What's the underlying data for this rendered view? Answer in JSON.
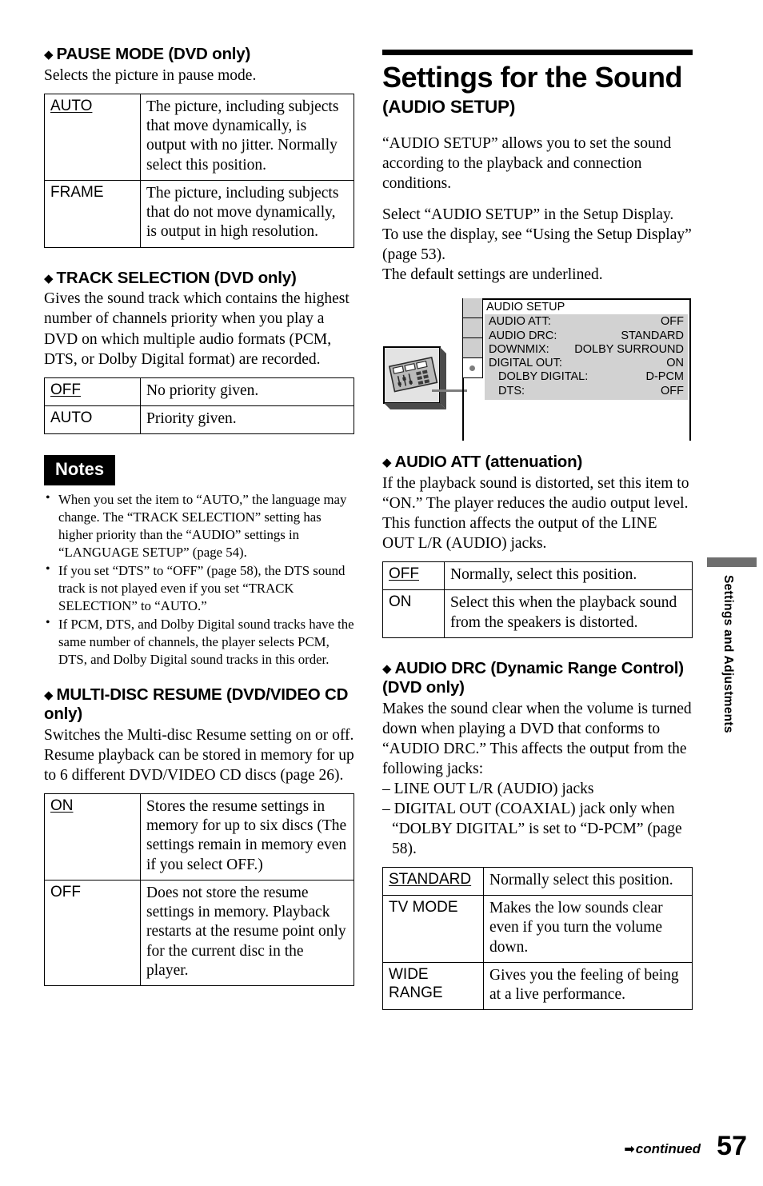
{
  "page": {
    "number": "57",
    "continued_label": "continued",
    "continued_arrow": "➡",
    "side_tab_label": "Settings and Adjustments"
  },
  "left_column": {
    "pause_mode": {
      "diamond": "◆",
      "heading": "PAUSE MODE (DVD only)",
      "intro": "Selects the picture in pause mode.",
      "table": [
        {
          "key": "AUTO",
          "default": true,
          "value": "The picture, including subjects that move dynamically, is output with no jitter. Normally select this position."
        },
        {
          "key": "FRAME",
          "default": false,
          "value": "The picture, including subjects that do not move dynamically, is output in high resolution."
        }
      ]
    },
    "track_selection": {
      "diamond": "◆",
      "heading": "TRACK SELECTION (DVD only)",
      "intro": "Gives the sound track which contains the highest number of channels priority when you play a DVD on which multiple audio formats (PCM, DTS, or Dolby Digital format) are recorded.",
      "table": [
        {
          "key": "OFF",
          "default": true,
          "value": "No priority given."
        },
        {
          "key": "AUTO",
          "default": false,
          "value": "Priority given."
        }
      ]
    },
    "notes": {
      "label": "Notes",
      "items": [
        "When you set the item to “AUTO,” the language may change. The “TRACK SELECTION” setting has higher priority than the “AUDIO” settings in “LANGUAGE SETUP” (page 54).",
        "If you set “DTS” to “OFF” (page 58), the DTS sound track is not played even if you set “TRACK SELECTION” to “AUTO.”",
        "If PCM, DTS, and Dolby Digital sound tracks have the same number of channels, the player selects PCM, DTS, and Dolby Digital sound tracks in this order."
      ]
    },
    "multi_disc_resume": {
      "diamond": "◆",
      "heading": "MULTI-DISC RESUME (DVD/VIDEO CD only)",
      "intro": "Switches the Multi-disc Resume setting on or off. Resume playback can be stored in memory for up to 6 different DVD/VIDEO CD discs (page 26).",
      "table": [
        {
          "key": "ON",
          "default": true,
          "value": "Stores the resume settings in memory for up to six discs (The settings remain in memory even if you select OFF.)"
        },
        {
          "key": "OFF",
          "default": false,
          "value": "Does not store the resume settings in memory. Playback restarts at the resume point only for the current disc in the player."
        }
      ]
    }
  },
  "right_column": {
    "chapter": {
      "title": "Settings for the Sound",
      "subtitle": "(AUDIO SETUP)"
    },
    "intro_1": "“AUDIO SETUP” allows you to set the sound according to the playback and connection conditions.",
    "intro_2": "Select “AUDIO SETUP” in the Setup Display. To use the display, see “Using the Setup Display” (page 53).",
    "intro_3": "The default settings are underlined.",
    "osd": {
      "icon_name": "audio-mixer-icon",
      "title": "AUDIO SETUP",
      "rows": [
        {
          "key": "AUDIO ATT:",
          "value": "OFF",
          "indent": false
        },
        {
          "key": "AUDIO DRC:",
          "value": "STANDARD",
          "indent": false
        },
        {
          "key": "DOWNMIX:",
          "value": "DOLBY SURROUND",
          "indent": false
        },
        {
          "key": "DIGITAL OUT:",
          "value": "ON",
          "indent": false
        },
        {
          "key": "DOLBY DIGITAL:",
          "value": "D-PCM",
          "indent": true
        },
        {
          "key": "DTS:",
          "value": "OFF",
          "indent": true
        }
      ],
      "tab_count": 4,
      "selected_tab_index": 3
    },
    "audio_att": {
      "diamond": "◆",
      "heading": "AUDIO ATT (attenuation)",
      "intro": "If the playback sound is distorted, set this item to “ON.” The player reduces the audio output level.\nThis function affects the output of the LINE OUT L/R (AUDIO) jacks.",
      "table": [
        {
          "key": "OFF",
          "default": true,
          "value": "Normally, select this position."
        },
        {
          "key": "ON",
          "default": false,
          "value": "Select this when the playback sound from the speakers is distorted."
        }
      ]
    },
    "audio_drc": {
      "diamond": "◆",
      "heading": "AUDIO DRC (Dynamic Range Control) (DVD only)",
      "intro": "Makes the sound clear when the volume is turned down when playing a DVD that conforms to “AUDIO DRC.” This affects the output from the following jacks:",
      "bullets": [
        "– LINE OUT L/R (AUDIO) jacks",
        "– DIGITAL OUT (COAXIAL) jack only when “DOLBY DIGITAL” is set to “D-PCM” (page 58)."
      ],
      "table": [
        {
          "key": "STANDARD",
          "default": true,
          "value": "Normally select this position."
        },
        {
          "key": "TV MODE",
          "default": false,
          "value": "Makes the low sounds clear even if you turn the volume down."
        },
        {
          "key": "WIDE\nRANGE",
          "default": false,
          "value": "Gives you the feeling of being at a live performance."
        }
      ]
    }
  }
}
